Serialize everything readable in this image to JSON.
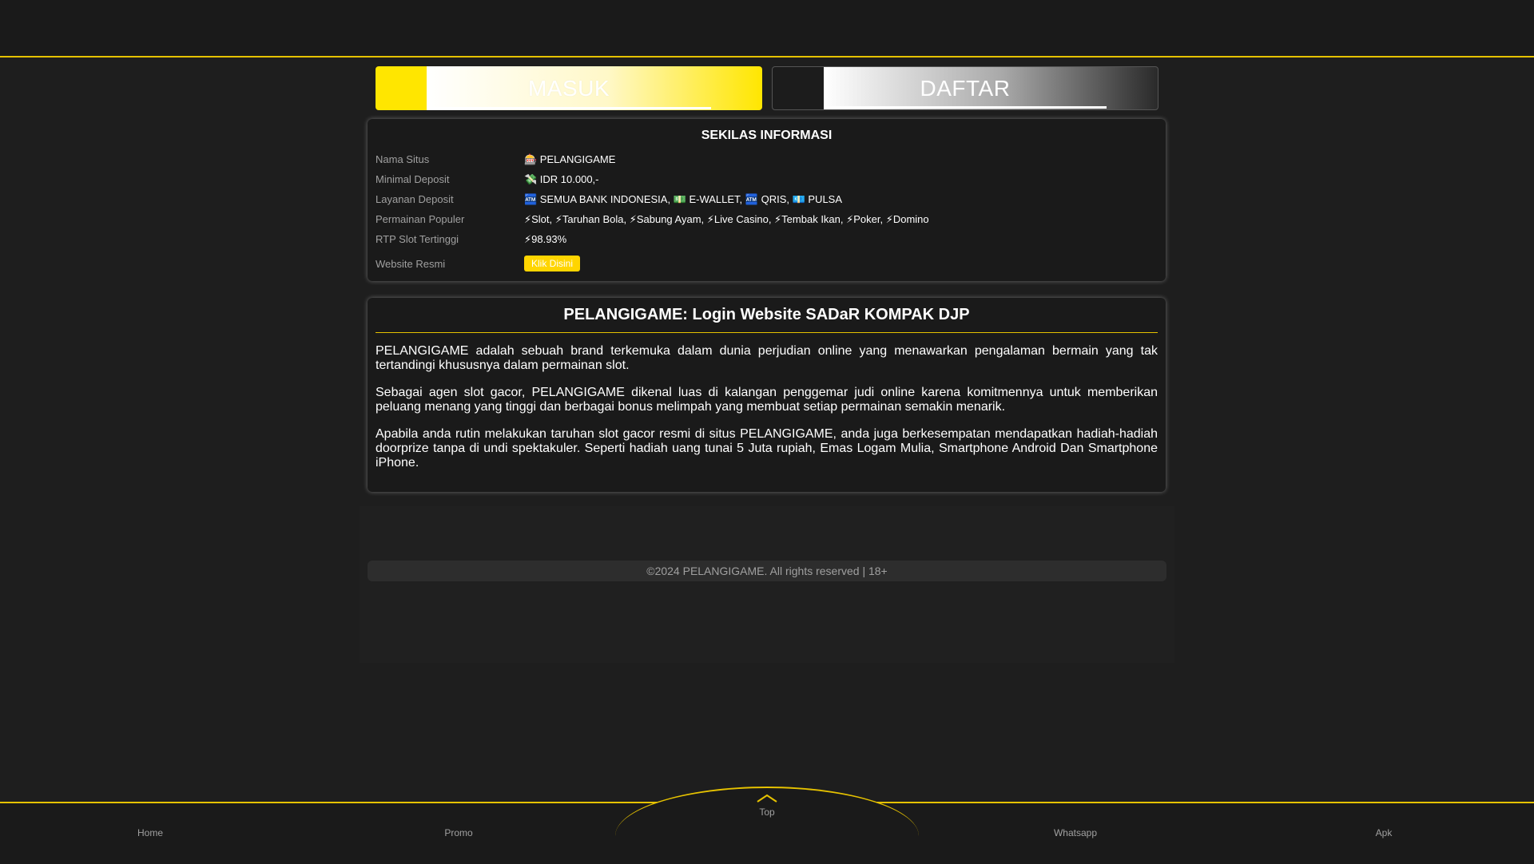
{
  "auth": {
    "login_label": "MASUK",
    "register_label": "DAFTAR"
  },
  "info": {
    "title": "SEKILAS INFORMASI",
    "rows": [
      {
        "key": "Nama Situs",
        "value": "🎰 PELANGIGAME"
      },
      {
        "key": "Minimal Deposit",
        "value": "💸 IDR 10.000,-"
      },
      {
        "key": "Layanan Deposit",
        "value": "🏧 SEMUA BANK INDONESIA, 💵 E-WALLET, 🏧 QRIS, 💶 PULSA"
      },
      {
        "key": "Permainan Populer",
        "value": "⚡Slot, ⚡Taruhan Bola, ⚡Sabung Ayam, ⚡Live Casino, ⚡Tembak Ikan, ⚡Poker, ⚡Domino"
      },
      {
        "key": "RTP Slot Tertinggi",
        "value": "⚡98.93%"
      }
    ],
    "website_key": "Website Resmi",
    "website_button": "Klik Disini"
  },
  "article": {
    "title": "PELANGIGAME: Login Website SADaR KOMPAK DJP",
    "paragraphs": [
      "PELANGIGAME adalah sebuah brand terkemuka dalam dunia perjudian online yang menawarkan pengalaman bermain yang tak tertandingi khususnya dalam permainan slot.",
      "Sebagai agen slot gacor, PELANGIGAME dikenal luas di kalangan penggemar judi online karena komitmennya untuk memberikan peluang menang yang tinggi dan berbagai bonus melimpah yang membuat setiap permainan semakin menarik.",
      "Apabila anda rutin melakukan taruhan slot gacor resmi di situs PELANGIGAME, anda juga berkesempatan mendapatkan hadiah-hadiah doorprize tanpa di undi spektakuler. Seperti hadiah uang tunai 5 Juta rupiah, Emas Logam Mulia, Smartphone Android Dan Smartphone iPhone."
    ]
  },
  "footer": {
    "copyright": "©2024 PELANGIGAME. All rights reserved | 18+"
  },
  "nav": {
    "home": "Home",
    "promo": "Promo",
    "top": "Top",
    "whatsapp": "Whatsapp",
    "apk": "Apk"
  },
  "colors": {
    "accent": "#ffd500",
    "background": "#1e1e1e",
    "panel": "#1a1a1a"
  }
}
